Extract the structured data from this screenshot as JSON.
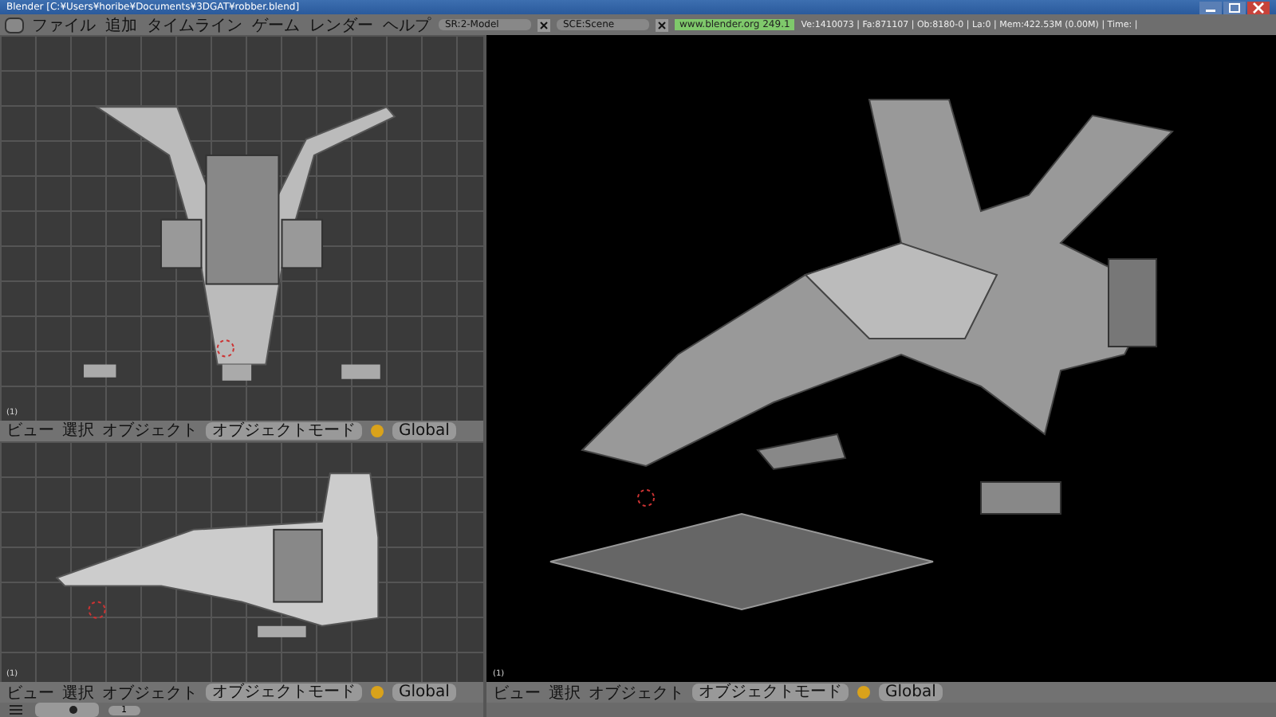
{
  "window": {
    "title": "Blender [C:¥Users¥horibe¥Documents¥3DGAT¥robber.blend]"
  },
  "menu": [
    "ファイル",
    "追加",
    "タイムライン",
    "ゲーム",
    "レンダー",
    "ヘルプ"
  ],
  "screen_field": {
    "value": "SR:2-Model"
  },
  "scene_field": {
    "value": "SCE:Scene"
  },
  "version_badge": "www.blender.org 249.1",
  "stats": "Ve:1410073 | Fa:871107 | Ob:8180-0 | La:0 | Mem:422.53M (0.00M) | Time: |",
  "viewports": [
    {
      "kind": "top",
      "frame_label": "(1)",
      "header": {
        "menus": [
          "ビュー",
          "選択",
          "オブジェクト"
        ],
        "mode": "オブジェクトモード",
        "orientation": "Global"
      }
    },
    {
      "kind": "side",
      "frame_label": "(1)",
      "header": {
        "menus": [
          "ビュー",
          "選択",
          "オブジェクト"
        ],
        "mode": "オブジェクトモード",
        "orientation": "Global"
      }
    },
    {
      "kind": "persp",
      "frame_label": "(1)",
      "header": {
        "menus": [
          "ビュー",
          "選択",
          "オブジェクト"
        ],
        "mode": "オブジェクトモード",
        "orientation": "Global"
      }
    }
  ],
  "buttons_panel": {
    "frame": "1"
  }
}
